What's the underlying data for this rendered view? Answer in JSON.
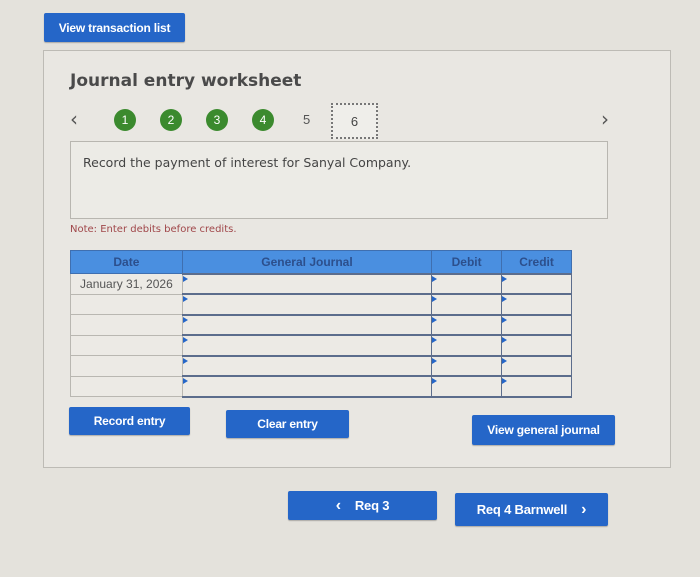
{
  "toolbar": {
    "view_transaction_list": "View transaction list"
  },
  "worksheet": {
    "title": "Journal entry worksheet",
    "steps": [
      {
        "label": "1",
        "state": "completed"
      },
      {
        "label": "2",
        "state": "completed"
      },
      {
        "label": "3",
        "state": "completed"
      },
      {
        "label": "4",
        "state": "completed"
      },
      {
        "label": "5",
        "state": "pending"
      },
      {
        "label": "6",
        "state": "current"
      }
    ],
    "prev_icon": "‹",
    "next_icon": "›",
    "instruction": "Record the payment of interest for Sanyal Company.",
    "note": "Note: Enter debits before credits."
  },
  "journal": {
    "headers": {
      "date": "Date",
      "general_journal": "General Journal",
      "debit": "Debit",
      "credit": "Credit"
    },
    "rows": [
      {
        "date": "January 31, 2026",
        "account": "",
        "debit": "",
        "credit": ""
      },
      {
        "date": "",
        "account": "",
        "debit": "",
        "credit": ""
      },
      {
        "date": "",
        "account": "",
        "debit": "",
        "credit": ""
      },
      {
        "date": "",
        "account": "",
        "debit": "",
        "credit": ""
      },
      {
        "date": "",
        "account": "",
        "debit": "",
        "credit": ""
      },
      {
        "date": "",
        "account": "",
        "debit": "",
        "credit": ""
      }
    ]
  },
  "actions": {
    "record_entry": "Record entry",
    "clear_entry": "Clear entry",
    "view_general_journal": "View general journal"
  },
  "navigation": {
    "prev_label": "Req 3",
    "prev_icon": "‹",
    "next_label": "Req 4 Barnwell",
    "next_icon": "›"
  },
  "colors": {
    "accent": "#2566c8",
    "step_done": "#3b8a2e",
    "header": "#4a8fe0",
    "note": "#a0474a"
  }
}
